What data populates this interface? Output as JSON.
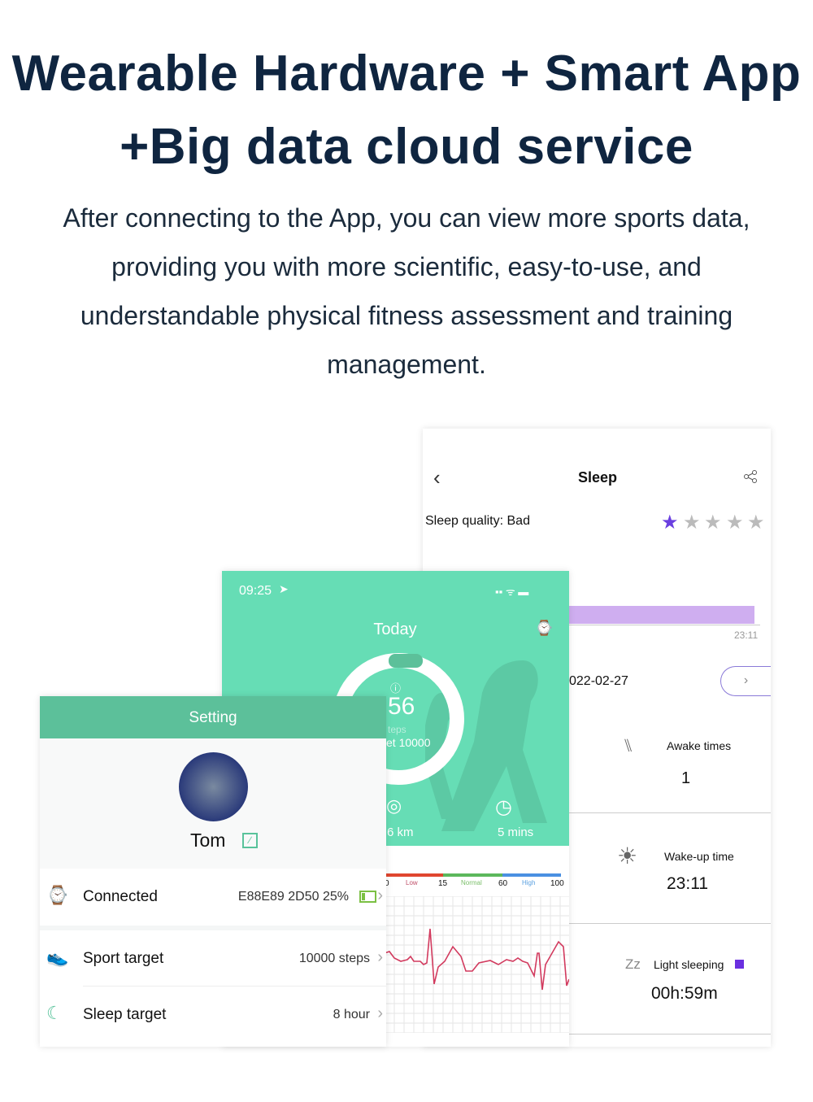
{
  "headline": {
    "line1": "Wearable Hardware + Smart App",
    "line2": "+Big data cloud service"
  },
  "description": "After connecting to the App, you can view more sports data, providing you with more scientific, easy-to-use, and understandable physical fitness assessment and training management.",
  "sleep_screen": {
    "title": "Sleep",
    "quality_label": "Sleep quality: Bad",
    "rating": 1,
    "rating_max": 5,
    "bar_end_time": "23:11",
    "date": "022-02-27",
    "awake_label": "Awake times",
    "awake_value": "1",
    "wake_label": "Wake-up time",
    "wake_value": "23:11",
    "light_label": "Light sleeping",
    "light_value": "00h:59m",
    "zz": "Zz",
    "colors": {
      "star": "#6a3fe0",
      "bar": "#cfaef0",
      "light": "#6a2fe0"
    }
  },
  "today_screen": {
    "time": "09:25",
    "title": "Today",
    "steps": "56",
    "steps_unit": "teps",
    "target": "et 10000",
    "distance": "6 km",
    "duration": "5 mins",
    "scale": {
      "ticks": [
        "0",
        "15",
        "60",
        "100"
      ],
      "zones": [
        "Low",
        "Normal",
        "High"
      ]
    },
    "colors": {
      "bg": "#66ddb5",
      "low": "#e0462f",
      "normal": "#5cb85c",
      "high": "#4a90e2",
      "ecg": "#d23a5e"
    }
  },
  "setting_screen": {
    "title": "Setting",
    "user_name": "Tom",
    "rows": [
      {
        "label": "Connected",
        "value": "E88E89 2D50 25%",
        "icon": "watch-icon"
      },
      {
        "label": "Sport target",
        "value": "10000 steps",
        "icon": "shoe-icon"
      },
      {
        "label": "Sleep target",
        "value": "8 hour",
        "icon": "moon-icon"
      }
    ],
    "battery_level": 0.25,
    "colors": {
      "header": "#5cc09a",
      "accent": "#59c39b"
    }
  }
}
